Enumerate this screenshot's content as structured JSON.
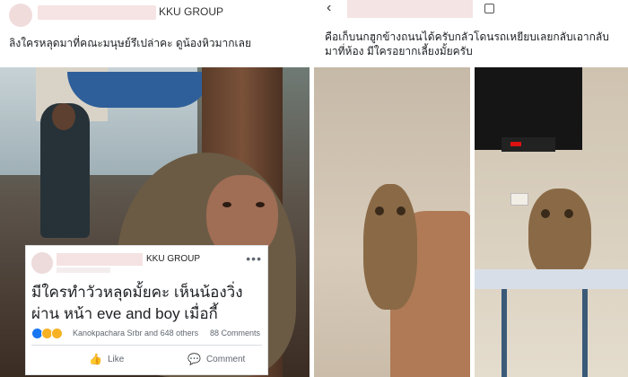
{
  "left_post": {
    "group_name": "KKU GROUP",
    "caption": "ลิงใครหลุดมาที่คณะมนุษย์รึเปล่าคะ ดูน้องหิวมากเลย",
    "photo_icon": "monkey-photo",
    "embedded_post": {
      "group_name": "KKU GROUP",
      "more_icon": "more-dots-icon",
      "text": "มีใครทำวัวหลุดมั้ยคะ เห็นน้องวิ่งผ่าน หน้า eve and boy เมื่อกี้",
      "reactions": [
        "like",
        "haha",
        "wow"
      ],
      "reaction_colors": [
        "#1877f2",
        "#f7b125",
        "#f7b125"
      ],
      "reactors_text": "Kanokpachara Srbr and 648 others",
      "comments_text": "88 Comments",
      "like_label": "Like",
      "comment_label": "Comment",
      "like_icon": "thumbs-up-icon",
      "comment_icon": "comment-icon"
    }
  },
  "right_post": {
    "back_icon": "back-arrow-icon",
    "caption": "คือเก็บนกฮูกข้างถนนได้ครับกลัวโดนรถเหยียบเลยกลับเอากลับมาที่ห้อง มีใครอยากเลี้ยงมั้ยครับ",
    "photos": [
      "owl-in-hand-photo",
      "owl-on-ironing-board-photo"
    ]
  }
}
